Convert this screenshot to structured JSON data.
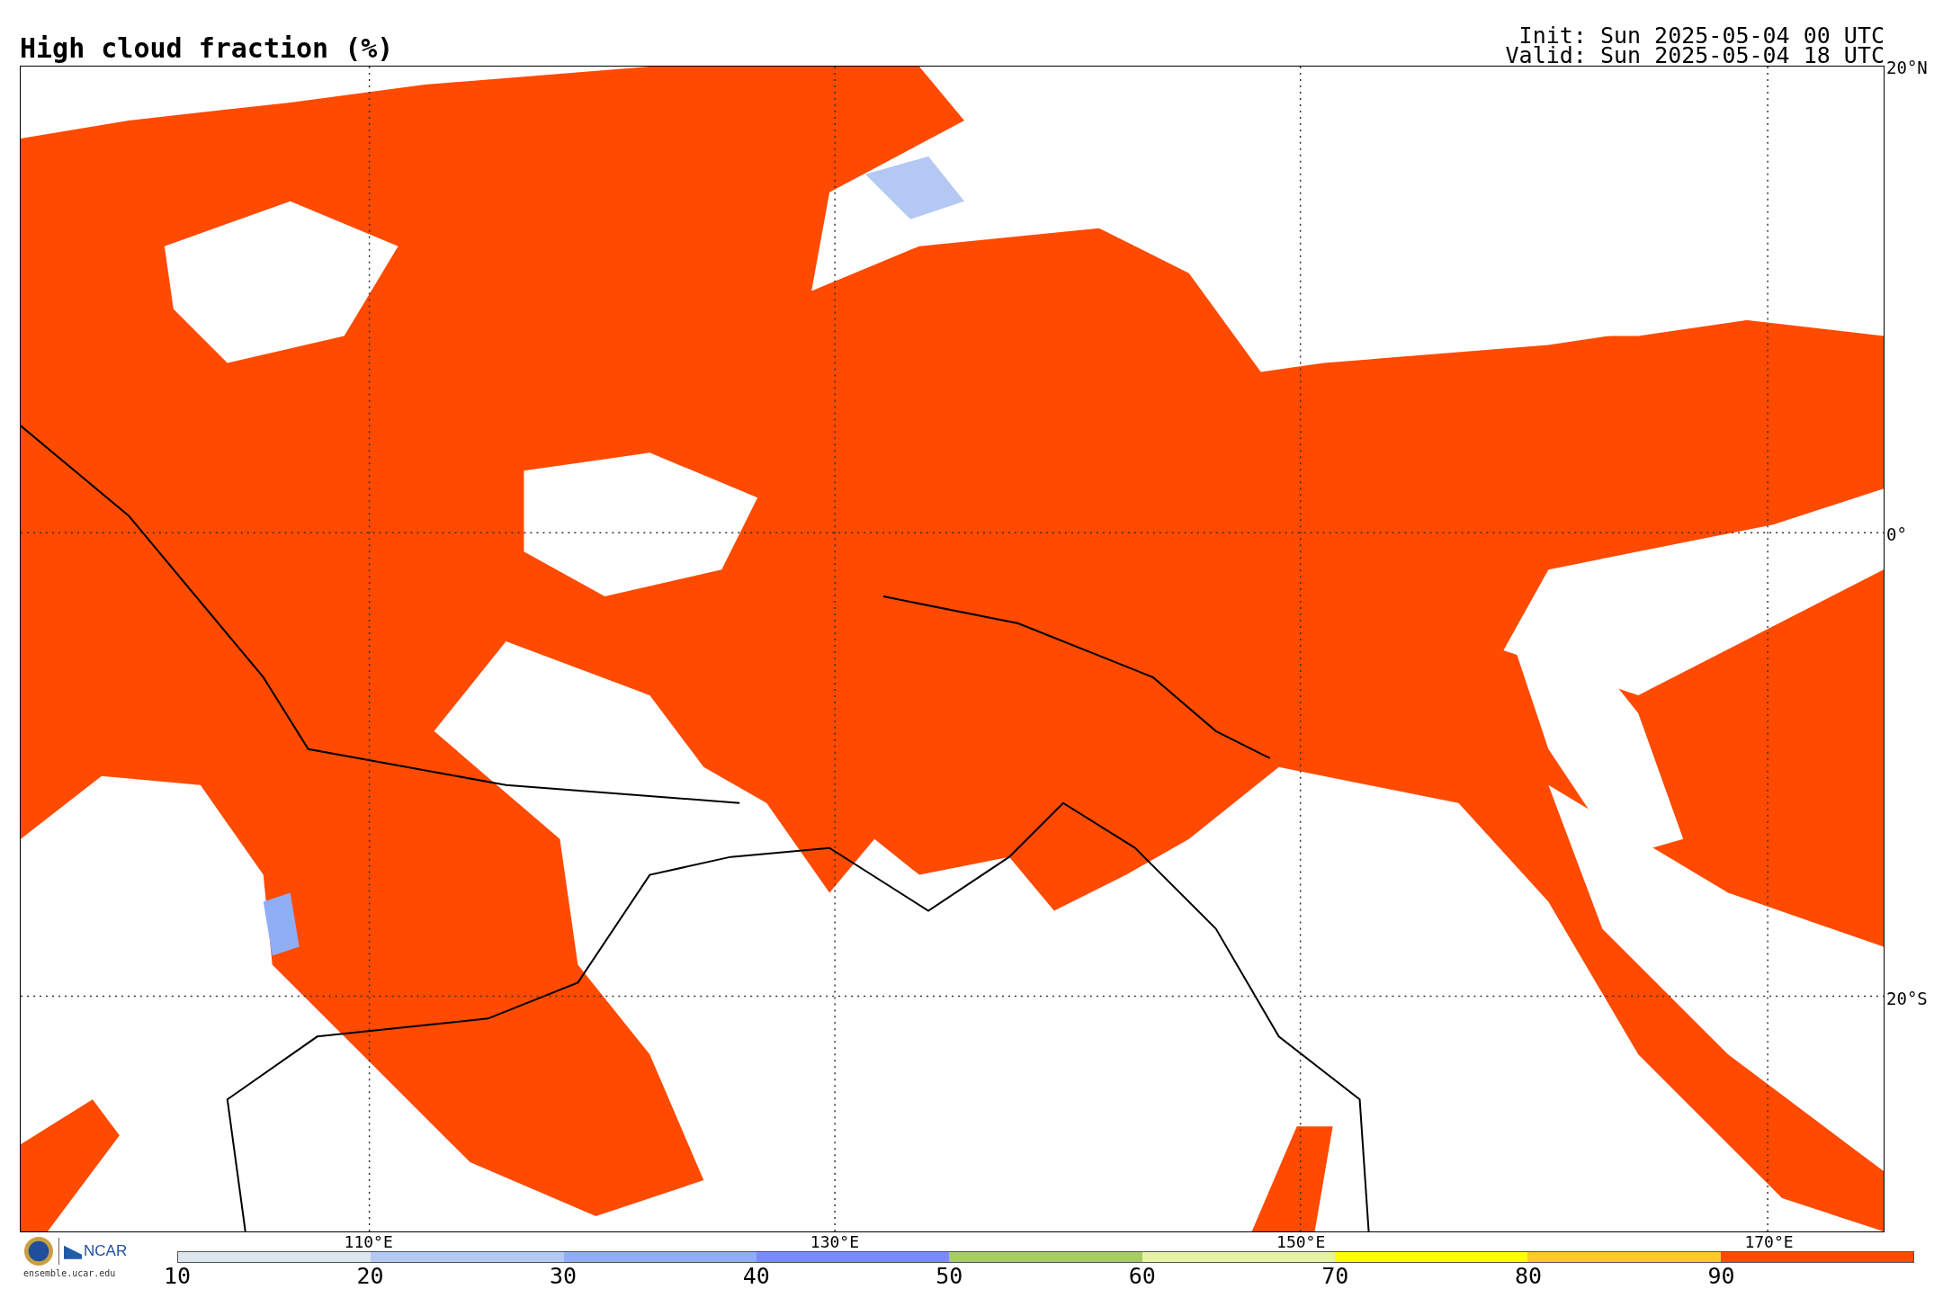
{
  "title": "High cloud fraction (%)",
  "run_info": [
    "Init: Sun 2025-05-04 00 UTC",
    "Valid: Sun 2025-05-04 18 UTC"
  ],
  "map": {
    "lat_labels": [
      "20°N",
      "0°",
      "20°S"
    ],
    "lon_labels": [
      "110°E",
      "130°E",
      "150°E",
      "170°E"
    ]
  },
  "logos": {
    "ncar": "NCAR",
    "site": "ensemble.ucar.edu"
  },
  "colorbar": {
    "segments": [
      {
        "color": "#dde6ee"
      },
      {
        "color": "#b4c8f4"
      },
      {
        "color": "#8faef6"
      },
      {
        "color": "#7b8cf4"
      },
      {
        "color": "#a6cc66"
      },
      {
        "color": "#e6f2a6"
      },
      {
        "color": "#ffff00"
      },
      {
        "color": "#ffc926"
      },
      {
        "color": "#ff4a00"
      }
    ],
    "tick_labels": [
      "10",
      "20",
      "30",
      "40",
      "50",
      "60",
      "70",
      "80",
      "90"
    ]
  }
}
